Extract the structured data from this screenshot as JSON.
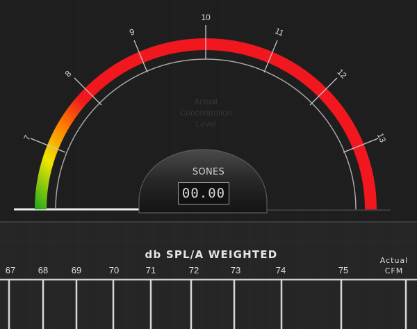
{
  "gauge": {
    "tick_labels": [
      "7",
      "8",
      "9",
      "10",
      "11",
      "12",
      "13"
    ],
    "watermark_lines": [
      "Actual",
      "Concentration",
      "Level"
    ],
    "readout_label": "SONES",
    "readout_value": "00.00",
    "colors": {
      "green": "#1fa81f",
      "yellow": "#f2e600",
      "orange": "#ff7a00",
      "red": "#f0171f"
    }
  },
  "scale": {
    "title": "db SPL/A WEIGHTED",
    "labels": [
      "67",
      "68",
      "69",
      "70",
      "71",
      "72",
      "73",
      "74",
      "75"
    ],
    "actual_label": "Actual",
    "cfm_label": "CFM"
  }
}
